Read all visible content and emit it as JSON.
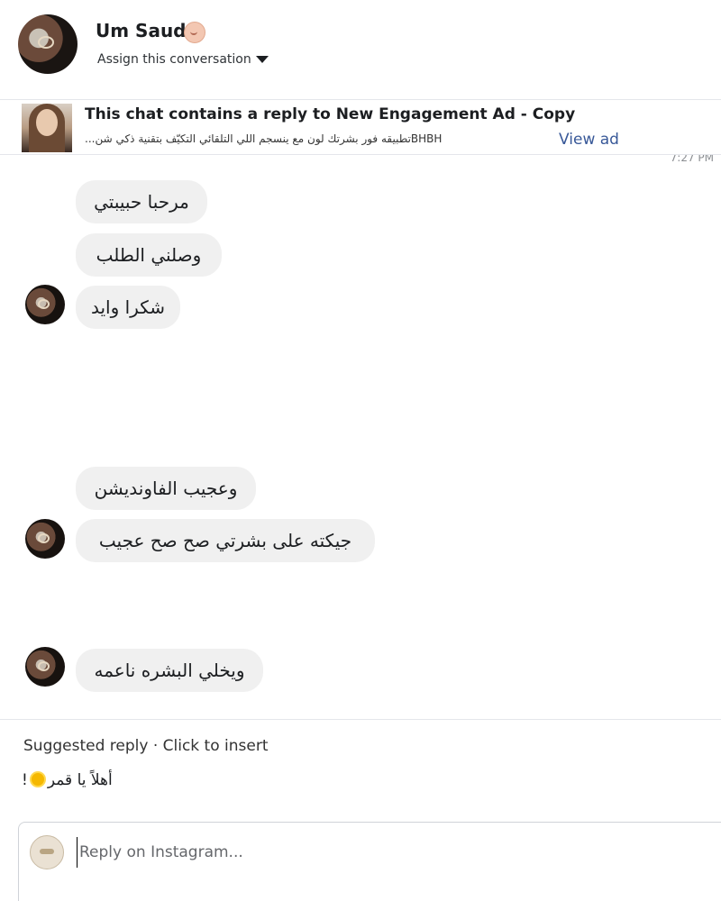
{
  "header": {
    "contact_name": "Um Saud",
    "assign_label": "Assign this conversation"
  },
  "ad_banner": {
    "title": "This chat contains a reply to New Engagement Ad - Copy",
    "description": "BHBHتطبيقه فور بشرتك لون مع ينسجم اللي التلقائي التكيّف بتقنية ذكي شن...",
    "view_ad_label": "View ad"
  },
  "timestamp": "7:27 PM",
  "messages": [
    {
      "text": "مرحبا حبيبتي"
    },
    {
      "text": "وصلني الطلب"
    },
    {
      "text": "شكرا وايد"
    },
    {
      "text": "وعجيب الفاونديشن"
    },
    {
      "text": "جيكته على بشرتي صح صح عجيب"
    },
    {
      "text": "ويخلي البشره ناعمه"
    }
  ],
  "suggested_reply": {
    "label": "Suggested reply · Click to insert",
    "text_before": "أهلاً يا قمر",
    "text_after": "!",
    "icon": "sun-icon"
  },
  "reply": {
    "placeholder": "Reply on Instagram..."
  }
}
